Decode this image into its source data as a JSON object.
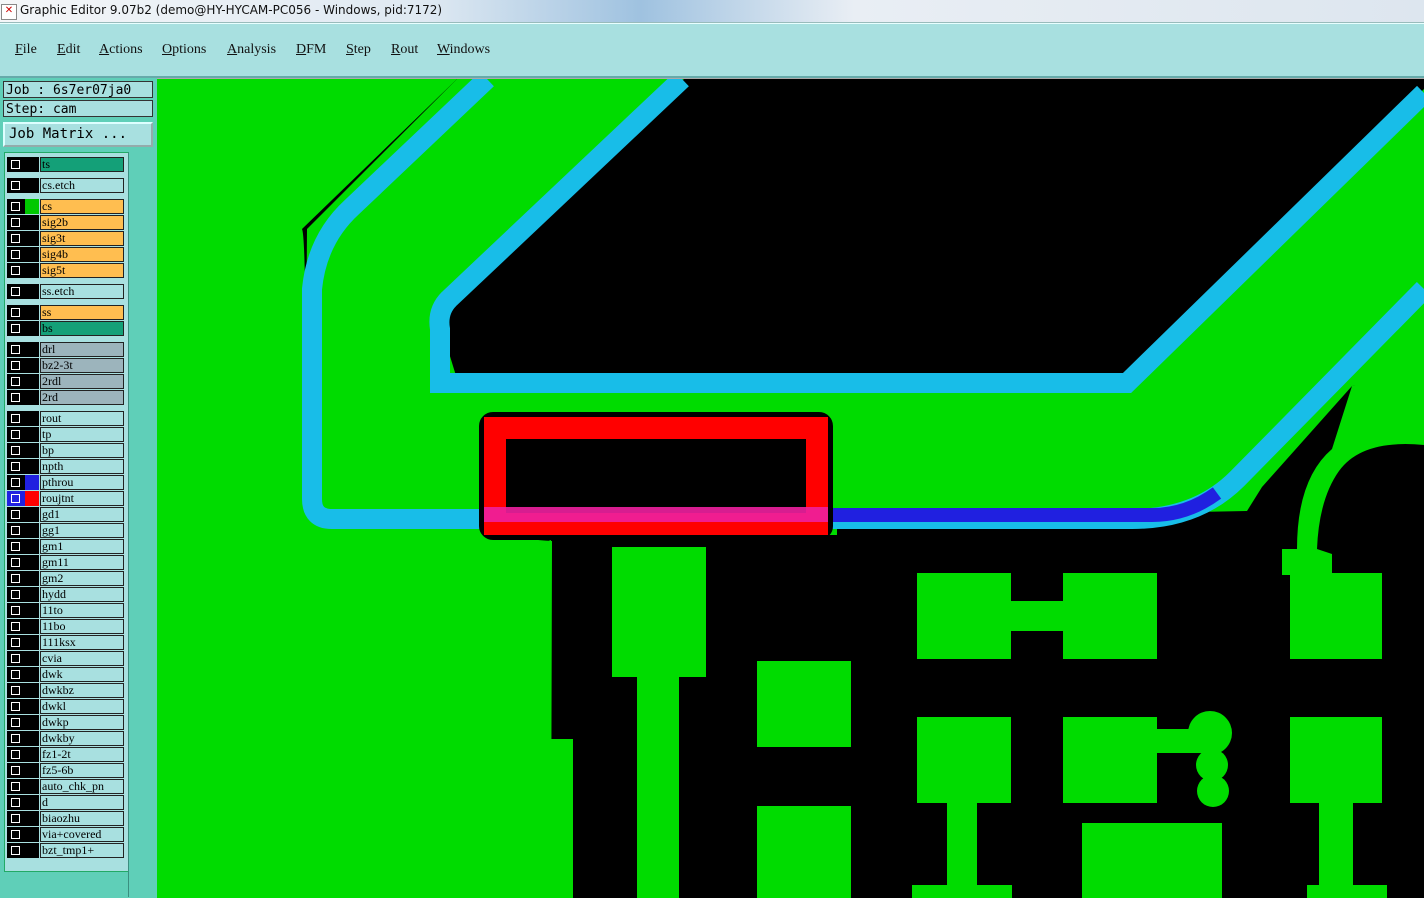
{
  "window": {
    "title": "Graphic Editor 9.07b2 (demo@HY-HYCAM-PC056 - Windows, pid:7172)"
  },
  "menu": [
    "File",
    "Edit",
    "Actions",
    "Options",
    "Analysis",
    "DFM",
    "Step",
    "Rout",
    "Windows"
  ],
  "job_info": {
    "job": "Job : 6s7er07ja0",
    "step": "Step: cam",
    "job_matrix": "Job Matrix ..."
  },
  "colors": {
    "board_copper": "#00dc00",
    "rout_path": "#18bde8",
    "highlight": "#ff0000",
    "overlap": "#2020e0",
    "panel": "#a8e0e0",
    "signal_layer": "#ffbe50",
    "drill_layer": "#9cb4bc",
    "solder_layer": "#14a078"
  },
  "layers": [
    {
      "name": "ts",
      "bg": "#14a078",
      "sw": "#000"
    },
    {
      "name": "cs.etch",
      "bg": "#a8e0e0",
      "sw": "#000"
    },
    {
      "name": "cs",
      "bg": "#ffbe50",
      "sw": "#00c800"
    },
    {
      "name": "sig2b",
      "bg": "#ffbe50",
      "sw": "#000"
    },
    {
      "name": "sig3t",
      "bg": "#ffbe50",
      "sw": "#000"
    },
    {
      "name": "sig4b",
      "bg": "#ffbe50",
      "sw": "#000"
    },
    {
      "name": "sig5t",
      "bg": "#ffbe50",
      "sw": "#000"
    },
    {
      "name": "ss.etch",
      "bg": "#a8e0e0",
      "sw": "#000"
    },
    {
      "name": "ss",
      "bg": "#ffbe50",
      "sw": "#000"
    },
    {
      "name": "bs",
      "bg": "#14a078",
      "sw": "#000"
    },
    {
      "name": "drl",
      "bg": "#9cb4bc",
      "sw": "#000"
    },
    {
      "name": "bz2-3t",
      "bg": "#9cb4bc",
      "sw": "#000"
    },
    {
      "name": "2rdl",
      "bg": "#9cb4bc",
      "sw": "#000"
    },
    {
      "name": "2rd",
      "bg": "#9cb4bc",
      "sw": "#000"
    },
    {
      "name": "rout",
      "bg": "#a8e0e0",
      "sw": "#000"
    },
    {
      "name": "tp",
      "bg": "#a8e0e0",
      "sw": "#000"
    },
    {
      "name": "bp",
      "bg": "#a8e0e0",
      "sw": "#000"
    },
    {
      "name": "npth",
      "bg": "#a8e0e0",
      "sw": "#000"
    },
    {
      "name": "pthrou",
      "bg": "#a8e0e0",
      "sw": "#2020e0"
    },
    {
      "name": "roujtnt",
      "bg": "#a8e0e0",
      "sw": "#ff0000",
      "active": true
    },
    {
      "name": "gd1",
      "bg": "#a8e0e0",
      "sw": "#000"
    },
    {
      "name": "gg1",
      "bg": "#a8e0e0",
      "sw": "#000"
    },
    {
      "name": "gm1",
      "bg": "#a8e0e0",
      "sw": "#000"
    },
    {
      "name": "gm11",
      "bg": "#a8e0e0",
      "sw": "#000"
    },
    {
      "name": "gm2",
      "bg": "#a8e0e0",
      "sw": "#000"
    },
    {
      "name": "hydd",
      "bg": "#a8e0e0",
      "sw": "#000"
    },
    {
      "name": "11to",
      "bg": "#a8e0e0",
      "sw": "#000"
    },
    {
      "name": "11bo",
      "bg": "#a8e0e0",
      "sw": "#000"
    },
    {
      "name": "111ksx",
      "bg": "#a8e0e0",
      "sw": "#000"
    },
    {
      "name": "cvia",
      "bg": "#a8e0e0",
      "sw": "#000"
    },
    {
      "name": "dwk",
      "bg": "#a8e0e0",
      "sw": "#000"
    },
    {
      "name": "dwkbz",
      "bg": "#a8e0e0",
      "sw": "#000"
    },
    {
      "name": "dwkl",
      "bg": "#a8e0e0",
      "sw": "#000"
    },
    {
      "name": "dwkp",
      "bg": "#a8e0e0",
      "sw": "#000"
    },
    {
      "name": "dwkby",
      "bg": "#a8e0e0",
      "sw": "#000"
    },
    {
      "name": "fz1-2t",
      "bg": "#a8e0e0",
      "sw": "#000"
    },
    {
      "name": "fz5-6b",
      "bg": "#a8e0e0",
      "sw": "#000"
    },
    {
      "name": "auto_chk_pn",
      "bg": "#a8e0e0",
      "sw": "#000"
    },
    {
      "name": "d",
      "bg": "#a8e0e0",
      "sw": "#000"
    },
    {
      "name": "biaozhu",
      "bg": "#a8e0e0",
      "sw": "#000"
    },
    {
      "name": "via+covered",
      "bg": "#a8e0e0",
      "sw": "#000"
    },
    {
      "name": "bzt_tmp1+",
      "bg": "#a8e0e0",
      "sw": "#000"
    }
  ]
}
